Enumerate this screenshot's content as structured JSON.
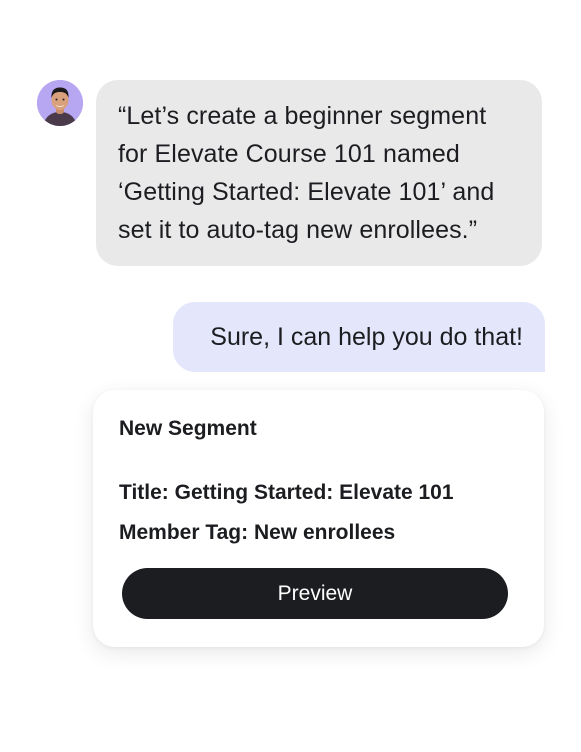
{
  "chat": {
    "user_message": "“Let’s create a beginner segment for Elevate Course 101 named ‘Getting Started: Elevate 101’ and set it to auto-tag new enrollees.”",
    "assistant_message": "Sure, I can help you do that!"
  },
  "segment_card": {
    "heading": "New Segment",
    "title_line": "Title: Getting Started: Elevate 101",
    "member_tag_line": "Member Tag: New enrollees",
    "preview_label": "Preview"
  },
  "colors": {
    "user_bubble": "#e9e9ea",
    "assistant_bubble": "#e4e7fb",
    "button": "#1c1d20",
    "avatar_bg": "#b7a6f2"
  }
}
